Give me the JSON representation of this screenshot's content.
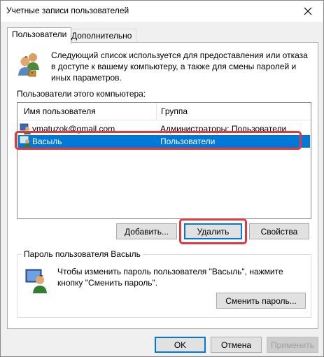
{
  "window": {
    "title": "Учетные записи пользователей"
  },
  "tabs": [
    {
      "label": "Пользователи",
      "active": true
    },
    {
      "label": "Дополнительно",
      "active": false
    }
  ],
  "description": "Следующий список используется для предоставления или отказа в доступе к вашему компьютеру, а также для смены паролей и иных параметров.",
  "users_label": "Пользователи этого компьютера:",
  "columns": {
    "name": "Имя пользователя",
    "group": "Группа"
  },
  "users": [
    {
      "name": "vmatuzok@gmail.com",
      "group": "Администраторы; Пользователи",
      "selected": false,
      "icon": "user-account-icon"
    },
    {
      "name": "Васыль",
      "group": "Пользователи",
      "selected": true,
      "icon": "user-account-icon"
    }
  ],
  "buttons": {
    "add": "Добавить...",
    "remove": "Удалить",
    "properties": "Свойства",
    "change_password": "Сменить пароль...",
    "ok": "OK",
    "cancel": "Отмена",
    "apply": "Применить"
  },
  "password_group": {
    "title": "Пароль пользователя Васыль",
    "text": "Чтобы изменить пароль пользователя \"Васыль\", нажмите кнопку \"Сменить пароль\"."
  },
  "colors": {
    "selection": "#0078d7",
    "highlight": "#e0383e"
  }
}
